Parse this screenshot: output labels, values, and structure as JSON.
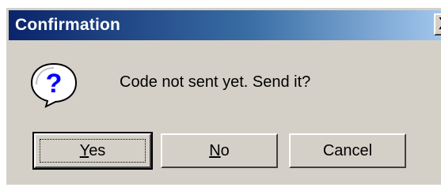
{
  "window": {
    "title": "Confirmation",
    "close_glyph": "X"
  },
  "message": {
    "icon": "question-icon",
    "text": "Code not sent yet. Send it?"
  },
  "buttons": {
    "yes": {
      "mnemonic": "Y",
      "rest": "es"
    },
    "no": {
      "mnemonic": "N",
      "rest": "o"
    },
    "cancel": {
      "label": "Cancel"
    }
  },
  "colors": {
    "dialog_bg": "#d4d0c8",
    "titlebar_start": "#0a246a",
    "titlebar_end": "#a6caf0",
    "icon_blue": "#0000ff"
  }
}
